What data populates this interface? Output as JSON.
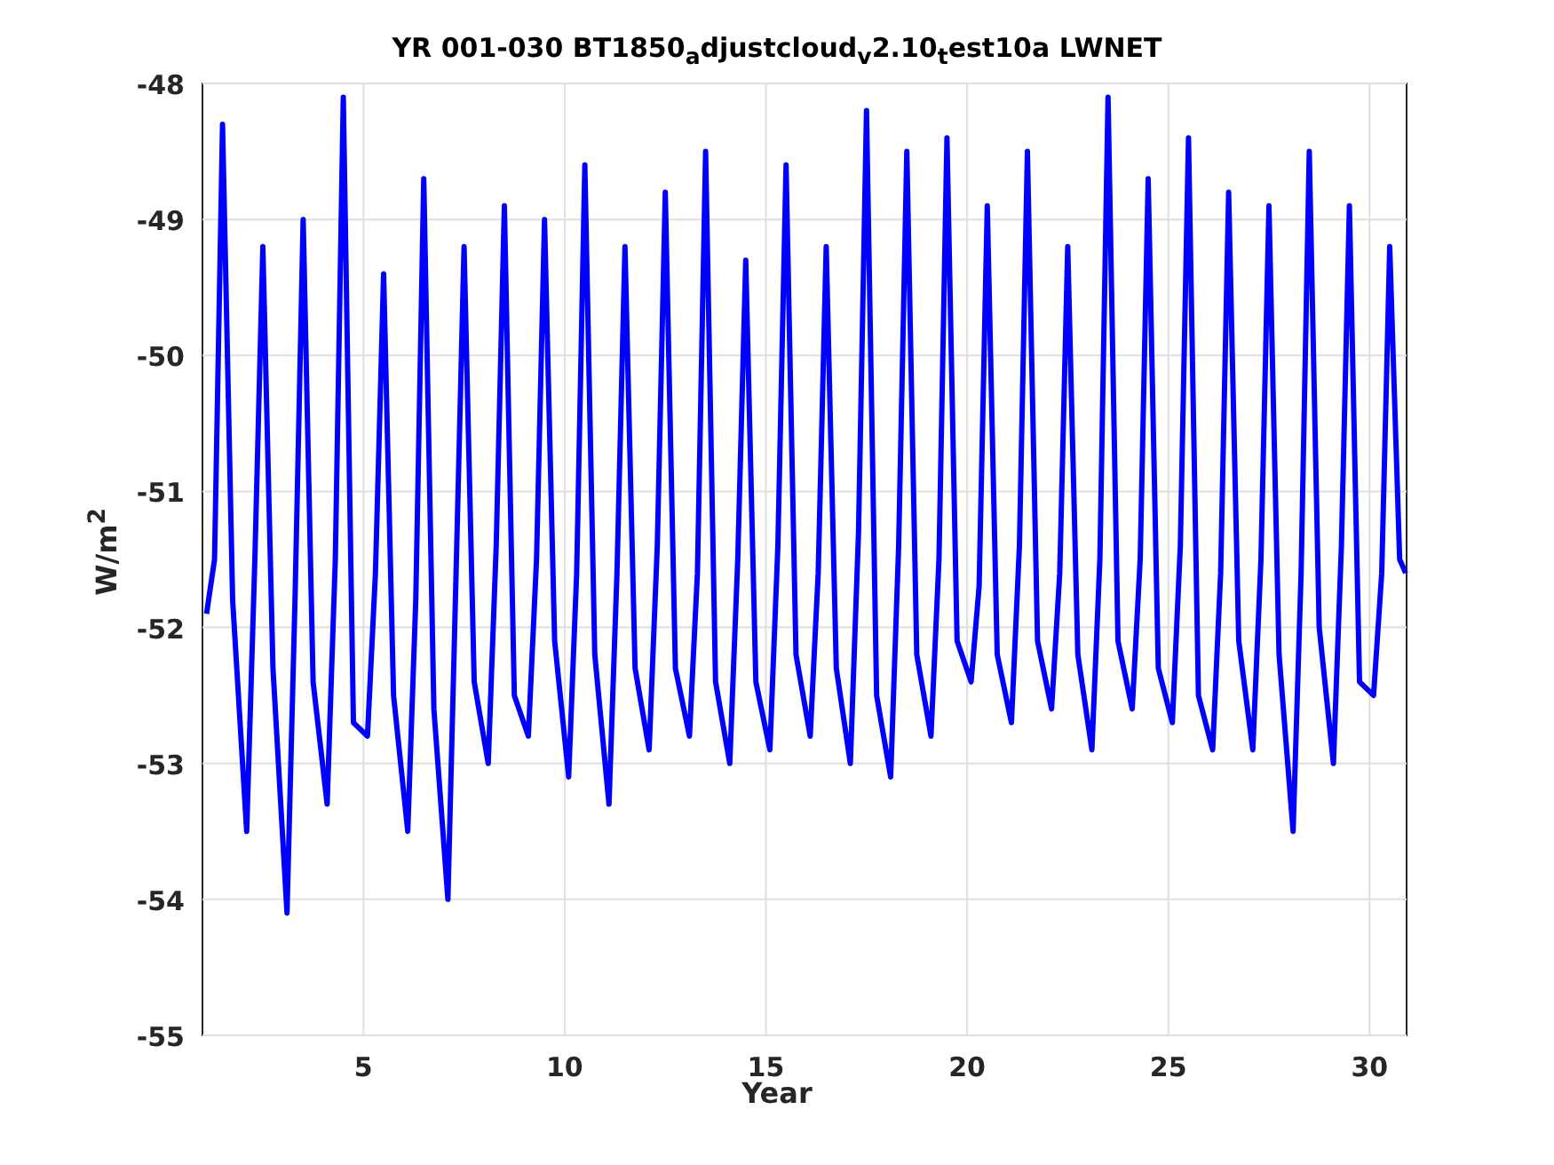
{
  "figure": {
    "chart_data": {
      "type": "line",
      "title": "YR 001-030 BT1850$_{a}$djustcloud$_{v}$2.10$_{t}$est10a LWNET",
      "xlabel": "Year",
      "ylabel": "W/m$^{2}$",
      "xlim": [
        1,
        30.92
      ],
      "ylim": [
        -55,
        -48
      ],
      "xticks": [
        5,
        10,
        15,
        20,
        25,
        30
      ],
      "yticks": [
        -55,
        -54,
        -53,
        -52,
        -51,
        -50,
        -49,
        -48
      ],
      "x": [
        1.1,
        1.3,
        1.5,
        1.75,
        2.1,
        2.3,
        2.5,
        2.75,
        3.1,
        3.3,
        3.5,
        3.75,
        4.1,
        4.3,
        4.5,
        4.75,
        5.1,
        5.3,
        5.5,
        5.75,
        6.1,
        6.3,
        6.5,
        6.75,
        7.1,
        7.3,
        7.5,
        7.75,
        8.1,
        8.3,
        8.5,
        8.75,
        9.1,
        9.3,
        9.5,
        9.75,
        10.1,
        10.3,
        10.5,
        10.75,
        11.1,
        11.3,
        11.5,
        11.75,
        12.1,
        12.3,
        12.5,
        12.75,
        13.1,
        13.3,
        13.5,
        13.75,
        14.1,
        14.3,
        14.5,
        14.75,
        15.1,
        15.3,
        15.5,
        15.75,
        16.1,
        16.3,
        16.5,
        16.75,
        17.1,
        17.3,
        17.5,
        17.75,
        18.1,
        18.3,
        18.5,
        18.75,
        19.1,
        19.3,
        19.5,
        19.75,
        20.1,
        20.3,
        20.5,
        20.75,
        21.1,
        21.3,
        21.5,
        21.75,
        22.1,
        22.3,
        22.5,
        22.75,
        23.1,
        23.3,
        23.5,
        23.75,
        24.1,
        24.3,
        24.5,
        24.75,
        25.1,
        25.3,
        25.5,
        25.75,
        26.1,
        26.3,
        26.5,
        26.75,
        27.1,
        27.3,
        27.5,
        27.75,
        28.1,
        28.3,
        28.5,
        28.75,
        29.1,
        29.3,
        29.5,
        29.75,
        30.1,
        30.3,
        30.5,
        30.75,
        30.9
      ],
      "grid": true,
      "series": [
        {
          "color": "#0000ff",
          "values": [
            -51.9,
            -51.5,
            -48.3,
            -51.8,
            -53.5,
            -51.5,
            -49.2,
            -52.3,
            -54.1,
            -51.8,
            -49.0,
            -52.4,
            -53.3,
            -51.5,
            -48.1,
            -52.7,
            -52.8,
            -51.6,
            -49.4,
            -52.5,
            -53.5,
            -51.8,
            -48.7,
            -52.6,
            -54.0,
            -51.6,
            -49.2,
            -52.4,
            -53.0,
            -51.4,
            -48.9,
            -52.5,
            -52.8,
            -51.5,
            -49.0,
            -52.1,
            -53.1,
            -51.6,
            -48.6,
            -52.2,
            -53.3,
            -51.6,
            -49.2,
            -52.3,
            -52.9,
            -51.4,
            -48.8,
            -52.3,
            -52.8,
            -51.6,
            -48.5,
            -52.4,
            -53.0,
            -51.5,
            -49.3,
            -52.4,
            -52.9,
            -51.4,
            -48.6,
            -52.2,
            -52.8,
            -51.6,
            -49.2,
            -52.3,
            -53.0,
            -51.3,
            -48.2,
            -52.5,
            -53.1,
            -51.4,
            -48.5,
            -52.2,
            -52.8,
            -51.5,
            -48.4,
            -52.1,
            -52.4,
            -51.7,
            -48.9,
            -52.2,
            -52.7,
            -51.4,
            -48.5,
            -52.1,
            -52.6,
            -51.6,
            -49.2,
            -52.2,
            -52.9,
            -51.5,
            -48.1,
            -52.1,
            -52.6,
            -51.5,
            -48.7,
            -52.3,
            -52.7,
            -51.4,
            -48.4,
            -52.5,
            -52.9,
            -51.6,
            -48.8,
            -52.1,
            -52.9,
            -51.5,
            -48.9,
            -52.2,
            -53.5,
            -51.6,
            -48.5,
            -52.0,
            -53.0,
            -51.4,
            -48.9,
            -52.4,
            -52.5,
            -51.6,
            -49.2,
            -51.5,
            -51.6
          ]
        }
      ]
    }
  }
}
